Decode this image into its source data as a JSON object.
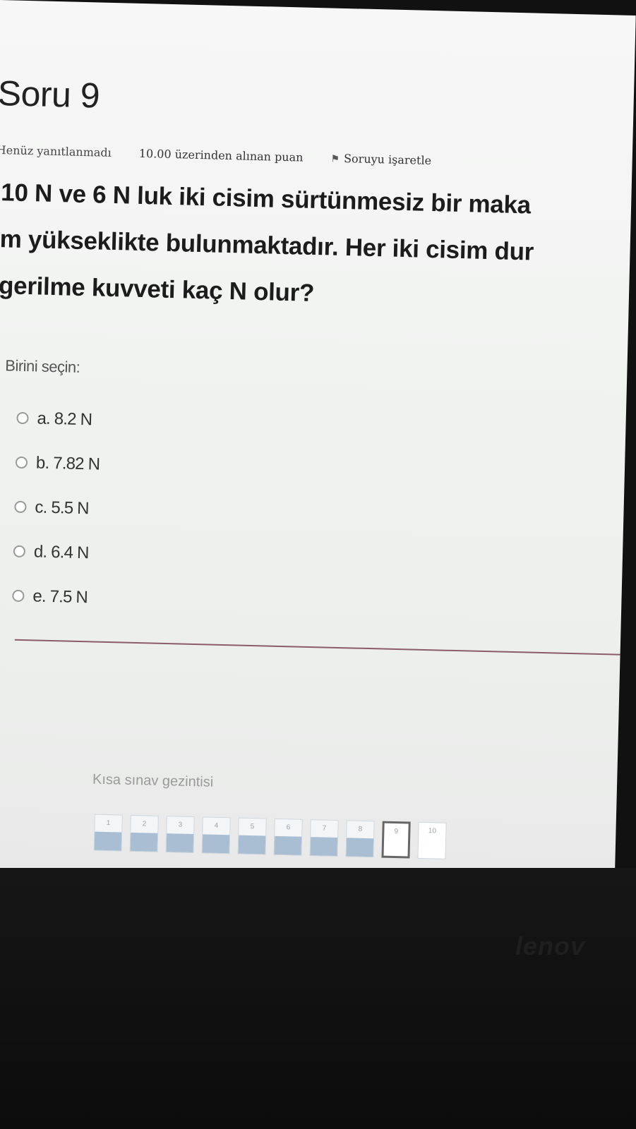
{
  "question": {
    "title": "Soru 9",
    "state": "Henüz yanıtlanmadı",
    "grade": "10.00 üzerinden alınan puan",
    "flag_label": "Soruyu işaretle",
    "text_lines": [
      "10 N ve 6 N luk iki cisim sürtünmesiz bir maka",
      "m yükseklikte bulunmaktadır. Her iki cisim dur",
      "gerilme kuvveti kaç N olur?"
    ],
    "prompt": "Birini seçin:",
    "answers": [
      "a. 8.2 N",
      "b. 7.82 N",
      "c. 5.5 N",
      "d. 6.4 N",
      "e. 7.5 N"
    ]
  },
  "navigation": {
    "title": "Kısa sınav gezintisi",
    "buttons": [
      "1",
      "2",
      "3",
      "4",
      "5",
      "6",
      "7",
      "8",
      "9",
      "10"
    ],
    "answered": [
      1,
      2,
      3,
      4,
      5,
      6,
      7,
      8
    ],
    "current": 9
  },
  "device": {
    "brand": "lenov"
  },
  "icons": {
    "flag": "flag-icon",
    "radio": "radio-unchecked-icon"
  },
  "colors": {
    "divider": "#8c5b6a",
    "answered_fill": "#a9bed2"
  }
}
